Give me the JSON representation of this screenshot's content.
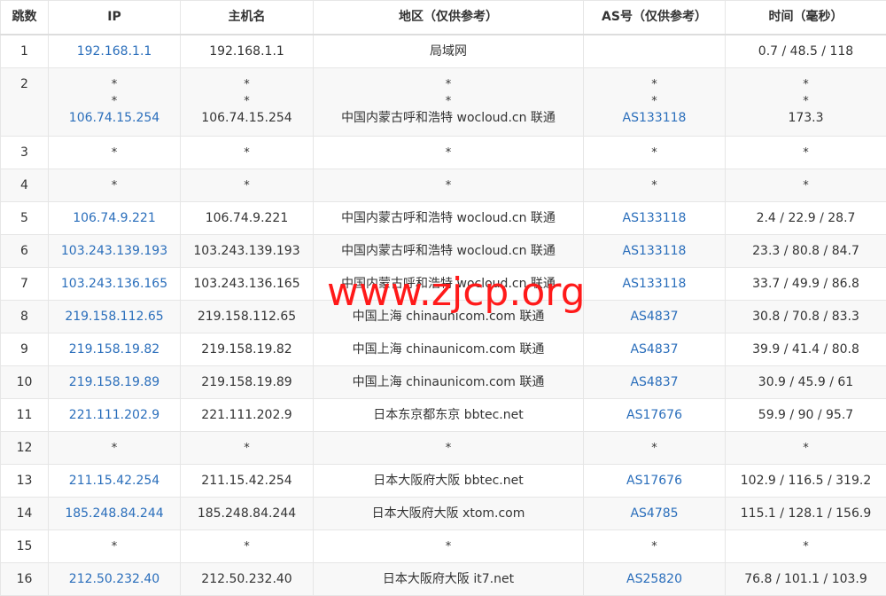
{
  "headers": [
    "跳数",
    "IP",
    "主机名",
    "地区（仅供参考）",
    "AS号（仅供参考）",
    "时间（毫秒）"
  ],
  "rows": [
    {
      "hop": "1",
      "lines": [
        {
          "ip": "192.168.1.1",
          "host": "192.168.1.1",
          "region": "局域网",
          "as": "",
          "time": "0.7 / 48.5 / 118"
        }
      ]
    },
    {
      "hop": "2",
      "lines": [
        {
          "ip": "*",
          "host": "*",
          "region": "*",
          "as": "*",
          "time": "*"
        },
        {
          "ip": "*",
          "host": "*",
          "region": "*",
          "as": "*",
          "time": "*"
        },
        {
          "ip": "106.74.15.254",
          "host": "106.74.15.254",
          "region": "中国内蒙古呼和浩特 wocloud.cn 联通",
          "as": "AS133118",
          "time": "173.3"
        }
      ]
    },
    {
      "hop": "3",
      "lines": [
        {
          "ip": "*",
          "host": "*",
          "region": "*",
          "as": "*",
          "time": "*"
        }
      ]
    },
    {
      "hop": "4",
      "lines": [
        {
          "ip": "*",
          "host": "*",
          "region": "*",
          "as": "*",
          "time": "*"
        }
      ]
    },
    {
      "hop": "5",
      "lines": [
        {
          "ip": "106.74.9.221",
          "host": "106.74.9.221",
          "region": "中国内蒙古呼和浩特 wocloud.cn 联通",
          "as": "AS133118",
          "time": "2.4 / 22.9 / 28.7"
        }
      ]
    },
    {
      "hop": "6",
      "lines": [
        {
          "ip": "103.243.139.193",
          "host": "103.243.139.193",
          "region": "中国内蒙古呼和浩特 wocloud.cn 联通",
          "as": "AS133118",
          "time": "23.3 / 80.8 / 84.7"
        }
      ]
    },
    {
      "hop": "7",
      "lines": [
        {
          "ip": "103.243.136.165",
          "host": "103.243.136.165",
          "region": "中国内蒙古呼和浩特 wocloud.cn 联通",
          "as": "AS133118",
          "time": "33.7 / 49.9 / 86.8"
        }
      ]
    },
    {
      "hop": "8",
      "lines": [
        {
          "ip": "219.158.112.65",
          "host": "219.158.112.65",
          "region": "中国上海 chinaunicom.com 联通",
          "as": "AS4837",
          "time": "30.8 / 70.8 / 83.3"
        }
      ]
    },
    {
      "hop": "9",
      "lines": [
        {
          "ip": "219.158.19.82",
          "host": "219.158.19.82",
          "region": "中国上海 chinaunicom.com 联通",
          "as": "AS4837",
          "time": "39.9 / 41.4 / 80.8"
        }
      ]
    },
    {
      "hop": "10",
      "lines": [
        {
          "ip": "219.158.19.89",
          "host": "219.158.19.89",
          "region": "中国上海 chinaunicom.com 联通",
          "as": "AS4837",
          "time": "30.9 / 45.9 / 61"
        }
      ]
    },
    {
      "hop": "11",
      "lines": [
        {
          "ip": "221.111.202.9",
          "host": "221.111.202.9",
          "region": "日本东京都东京 bbtec.net",
          "as": "AS17676",
          "time": "59.9 / 90 / 95.7"
        }
      ]
    },
    {
      "hop": "12",
      "lines": [
        {
          "ip": "*",
          "host": "*",
          "region": "*",
          "as": "*",
          "time": "*"
        }
      ]
    },
    {
      "hop": "13",
      "lines": [
        {
          "ip": "211.15.42.254",
          "host": "211.15.42.254",
          "region": "日本大阪府大阪 bbtec.net",
          "as": "AS17676",
          "time": "102.9 / 116.5 / 319.2"
        }
      ]
    },
    {
      "hop": "14",
      "lines": [
        {
          "ip": "185.248.84.244",
          "host": "185.248.84.244",
          "region": "日本大阪府大阪 xtom.com",
          "as": "AS4785",
          "time": "115.1 / 128.1 / 156.9"
        }
      ]
    },
    {
      "hop": "15",
      "lines": [
        {
          "ip": "*",
          "host": "*",
          "region": "*",
          "as": "*",
          "time": "*"
        }
      ]
    },
    {
      "hop": "16",
      "lines": [
        {
          "ip": "212.50.232.40",
          "host": "212.50.232.40",
          "region": "日本大阪府大阪 it7.net",
          "as": "AS25820",
          "time": "76.8 / 101.1 / 103.9"
        }
      ]
    }
  ],
  "watermark": "www.zjcp.org",
  "colors": {
    "link": "#2a6ebb",
    "watermark": "#ff1a1a",
    "stripe": "#f8f8f8",
    "border": "#e6e6e6"
  }
}
